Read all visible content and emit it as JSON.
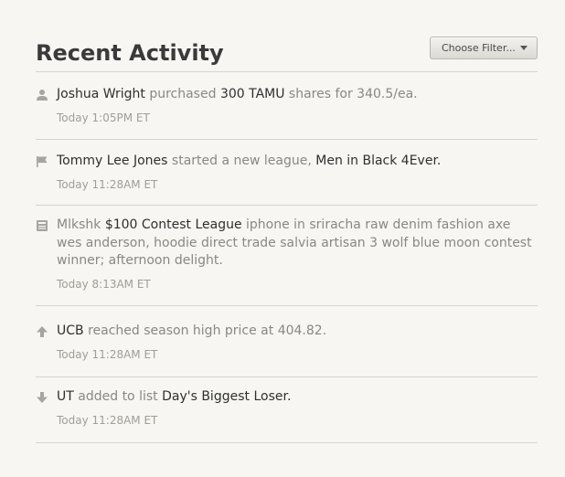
{
  "header": {
    "title": "Recent Activity",
    "filter_label": "Choose Filter..."
  },
  "colors": {
    "background": "#f7f6f2",
    "text_muted": "#8b8782",
    "text_strong": "#2f2f2f",
    "divider": "#d7d4cf",
    "icon": "#a8a49f"
  },
  "activity": [
    {
      "icon": "user-icon",
      "parts": [
        {
          "text": "Joshua Wright",
          "strong": true
        },
        {
          "text": " purchased ",
          "strong": false
        },
        {
          "text": "300 TAMU",
          "strong": true
        },
        {
          "text": " shares for 340.5/ea.",
          "strong": false
        }
      ],
      "time": "Today 1:05PM ET"
    },
    {
      "icon": "flag-icon",
      "parts": [
        {
          "text": "Tommy Lee Jones",
          "strong": true
        },
        {
          "text": " started a new league, ",
          "strong": false
        },
        {
          "text": "Men in Black 4Ever.",
          "strong": true
        }
      ],
      "time": "Today 11:28AM ET"
    },
    {
      "icon": "newspaper-icon",
      "parts": [
        {
          "text": "Mlkshk ",
          "strong": false
        },
        {
          "text": "$100 Contest League",
          "strong": true
        },
        {
          "text": " iphone in sriracha raw denim fashion axe wes anderson, hoodie direct trade salvia artisan 3 wolf blue moon contest winner; afternoon delight.",
          "strong": false
        }
      ],
      "time": "Today 8:13AM ET"
    },
    {
      "icon": "arrow-up-icon",
      "parts": [
        {
          "text": "UCB",
          "strong": true
        },
        {
          "text": " reached season high price at 404.82.",
          "strong": false
        }
      ],
      "time": "Today 11:28AM ET"
    },
    {
      "icon": "arrow-down-icon",
      "parts": [
        {
          "text": "UT",
          "strong": true
        },
        {
          "text": " added to list ",
          "strong": false
        },
        {
          "text": "Day's Biggest Loser.",
          "strong": true
        }
      ],
      "time": "Today 11:28AM ET"
    }
  ]
}
